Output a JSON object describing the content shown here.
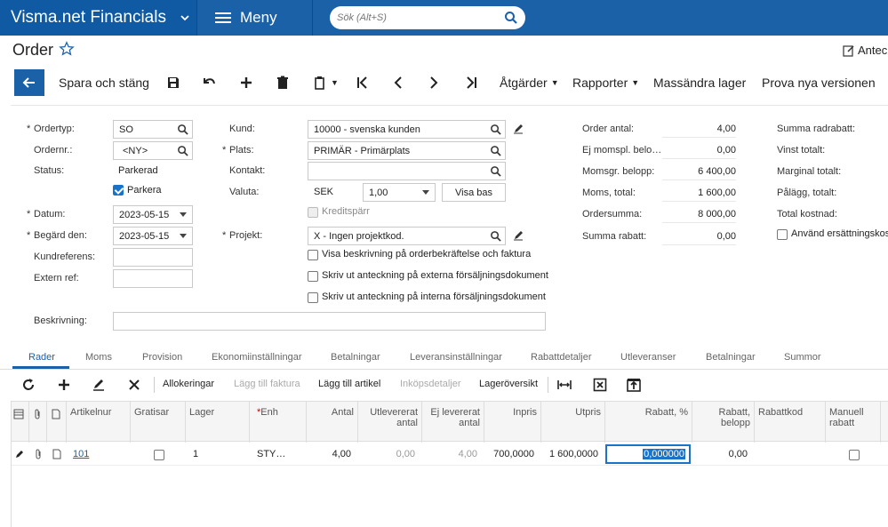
{
  "topbar": {
    "brand": "Visma.net Financials",
    "menu_label": "Meny",
    "search_placeholder": "Sök (Alt+S)"
  },
  "header": {
    "title": "Order",
    "notes_label": "Antec"
  },
  "toolbar": {
    "save_close": "Spara och stäng",
    "actions": "Åtgärder",
    "reports": "Rapporter",
    "mass_update": "Massändra lager",
    "try_new": "Prova nya versionen"
  },
  "form": {
    "ordertype_label": "Ordertyp:",
    "ordertype_value": "SO",
    "ordernr_label": "Ordernr.:",
    "ordernr_value": "<NY>",
    "status_label": "Status:",
    "status_value": "Parkerad",
    "park_label": "Parkera",
    "date_label": "Datum:",
    "date_value": "2023-05-15",
    "requested_label": "Begärd den:",
    "requested_value": "2023-05-15",
    "custref_label": "Kundreferens:",
    "extref_label": "Extern ref:",
    "description_label": "Beskrivning:",
    "customer_label": "Kund:",
    "customer_value": "10000 - svenska kunden",
    "location_label": "Plats:",
    "location_value": "PRIMÄR - Primärplats",
    "contact_label": "Kontakt:",
    "currency_label": "Valuta:",
    "currency_value": "SEK",
    "rate_value": "1,00",
    "show_base": "Visa bas",
    "credit_hold": "Kreditspärr",
    "project_label": "Projekt:",
    "project_value": "X - Ingen projektkod.",
    "opt1": "Visa beskrivning på orderbekräftelse och faktura",
    "opt2": "Skriv ut anteckning på externa försäljningsdokument",
    "opt3": "Skriv ut anteckning på interna försäljningsdokument"
  },
  "summary": {
    "order_qty_label": "Order antal:",
    "order_qty": "4,00",
    "nontax_label": "Ej momspl. belo…",
    "nontax": "0,00",
    "taxable_label": "Momsgr. belopp:",
    "taxable": "6 400,00",
    "vat_label": "Moms, total:",
    "vat": "1 600,00",
    "ordersum_label": "Ordersumma:",
    "ordersum": "8 000,00",
    "discount_label": "Summa rabatt:",
    "discount": "0,00",
    "linedisc_label": "Summa radrabatt:",
    "profit_label": "Vinst totalt:",
    "margin_label": "Marginal totalt:",
    "markup_label": "Pålägg, totalt:",
    "cost_label": "Total kostnad:",
    "replace_label": "Använd ersättningskost"
  },
  "tabs": [
    "Rader",
    "Moms",
    "Provision",
    "Ekonomiinställningar",
    "Betalningar",
    "Leveransinställningar",
    "Rabattdetaljer",
    "Utleveranser",
    "Betalningar",
    "Summor"
  ],
  "grid_toolbar": {
    "allocations": "Allokeringar",
    "add_invoice": "Lägg till faktura",
    "add_item": "Lägg till artikel",
    "purchase_details": "Inköpsdetaljer",
    "stock_overview": "Lageröversikt"
  },
  "grid": {
    "headers": {
      "item": "Artikelnur",
      "free": "Gratisar",
      "warehouse": "Lager",
      "unit": "Enh",
      "qty": "Antal",
      "shipped": "Utlevererat antal",
      "not_shipped": "Ej levererat antal",
      "cost": "Inpris",
      "price": "Utpris",
      "disc_pct": "Rabatt, %",
      "disc_amt": "Rabatt, belopp",
      "disc_code": "Rabattkod",
      "manual": "Manuell rabatt"
    },
    "row": {
      "item": "101",
      "warehouse": "1",
      "unit": "STY…",
      "qty": "4,00",
      "shipped": "0,00",
      "not_shipped": "4,00",
      "cost": "700,0000",
      "price": "1 600,0000",
      "disc_pct": "0,000000",
      "disc_amt": "0,00"
    }
  }
}
